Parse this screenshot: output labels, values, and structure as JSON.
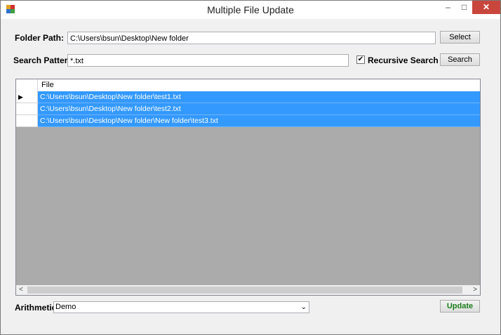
{
  "window": {
    "title": "Multiple File Update",
    "minimize_icon": "–",
    "maximize_icon": "□",
    "close_icon": "✕"
  },
  "folder": {
    "label": "Folder Path:",
    "value": "C:\\Users\\bsun\\Desktop\\New folder",
    "button": "Select"
  },
  "search": {
    "label": "Search Pattern:",
    "value": "*.txt",
    "recursive_label": "Recursive Search",
    "recursive_checked": true,
    "check_glyph": "✔",
    "button": "Search"
  },
  "grid": {
    "column": "File",
    "current_row_marker": "▶",
    "rows": [
      {
        "file": "C:\\Users\\bsun\\Desktop\\New folder\\test1.txt"
      },
      {
        "file": "C:\\Users\\bsun\\Desktop\\New folder\\test2.txt"
      },
      {
        "file": "C:\\Users\\bsun\\Desktop\\New folder\\New folder\\test3.txt"
      }
    ],
    "scroll_left": "<",
    "scroll_right": ">"
  },
  "arithmetic": {
    "label": "Arithmetic:",
    "selected": "Demo",
    "dropdown_glyph": "⌄"
  },
  "update_button": "Update",
  "colors": {
    "selection": "#3399ff",
    "grid_bg": "#ababab",
    "update_text": "#1a7f1a",
    "close": "#c9463d"
  }
}
